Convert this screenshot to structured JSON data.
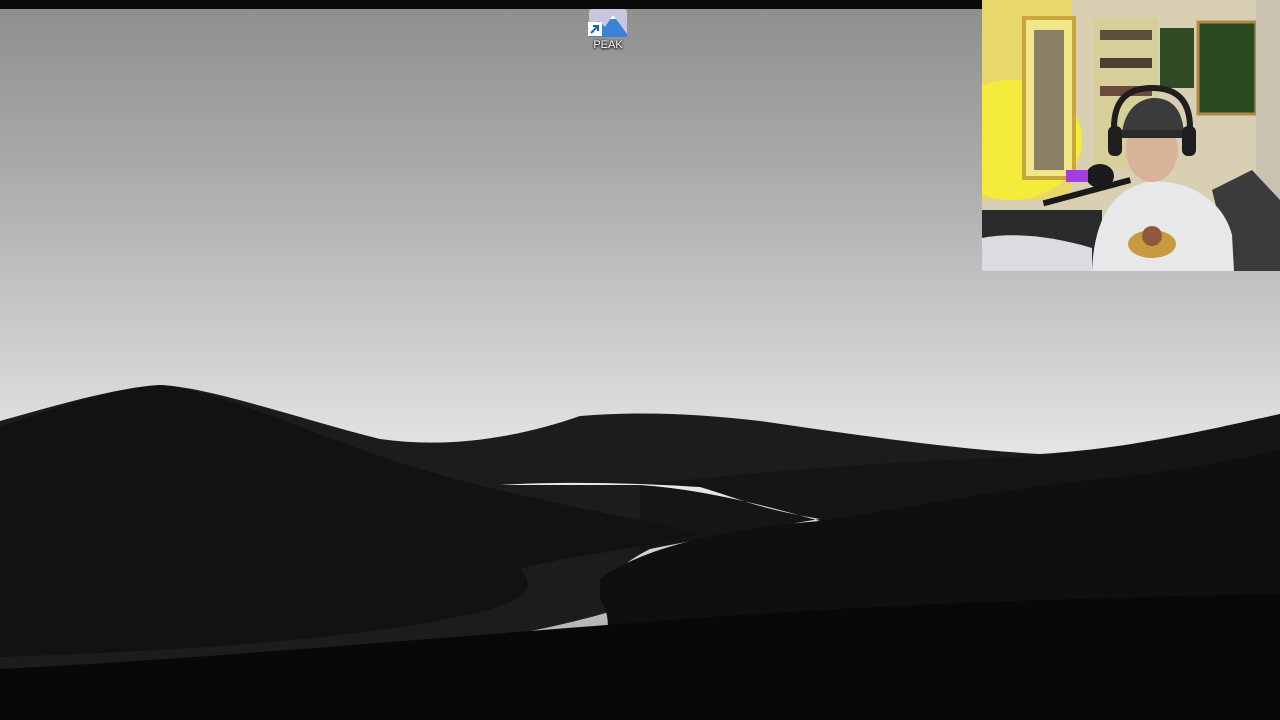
{
  "desktop": {
    "icons": [
      {
        "label": "PEAK",
        "icon": "peak-mountain-icon",
        "shortcut_overlay": "shortcut-arrow-icon"
      }
    ]
  },
  "overlay": {
    "webcam": {
      "icon": "streamer-webcam-feed"
    }
  },
  "colors": {
    "sky_top": "#8f8f8f",
    "sky_bottom": "#efefef",
    "dunes": "#141414",
    "river": "#d8d8d8"
  }
}
